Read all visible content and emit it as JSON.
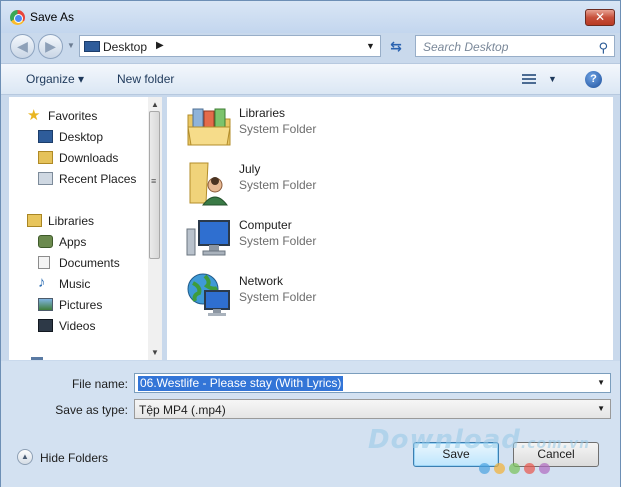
{
  "window": {
    "title": "Save As",
    "close_glyph": "✕"
  },
  "navbar": {
    "address": "Desktop",
    "search_placeholder": "Search Desktop"
  },
  "toolbar": {
    "organize_label": "Organize ▾",
    "new_folder_label": "New folder"
  },
  "sidebar": {
    "favorites": {
      "label": "Favorites",
      "items": [
        {
          "label": "Desktop",
          "icon": "desktop-icon"
        },
        {
          "label": "Downloads",
          "icon": "downloads-icon"
        },
        {
          "label": "Recent Places",
          "icon": "recent-places-icon"
        }
      ]
    },
    "libraries": {
      "label": "Libraries",
      "items": [
        {
          "label": "Apps",
          "icon": "apps-icon"
        },
        {
          "label": "Documents",
          "icon": "documents-icon"
        },
        {
          "label": "Music",
          "icon": "music-icon"
        },
        {
          "label": "Pictures",
          "icon": "pictures-icon"
        },
        {
          "label": "Videos",
          "icon": "videos-icon"
        }
      ]
    }
  },
  "content": {
    "items": [
      {
        "name": "Libraries",
        "type": "System Folder",
        "icon": "libraries-folder-icon"
      },
      {
        "name": "July",
        "type": "System Folder",
        "icon": "user-folder-icon"
      },
      {
        "name": "Computer",
        "type": "System Folder",
        "icon": "computer-icon"
      },
      {
        "name": "Network",
        "type": "System Folder",
        "icon": "network-icon"
      }
    ]
  },
  "form": {
    "file_name_label": "File name:",
    "file_name_value": "06.Westlife - Please stay (With Lyrics)",
    "save_type_label": "Save as type:",
    "save_type_value": "Tệp MP4 (.mp4)",
    "hide_folders_label": "Hide Folders",
    "save_label": "Save",
    "cancel_label": "Cancel"
  },
  "watermark": {
    "brand": "Download",
    "suffix": ".com.vn"
  },
  "colors": {
    "selection": "#3375d7",
    "frame": "#c9d9ec"
  }
}
